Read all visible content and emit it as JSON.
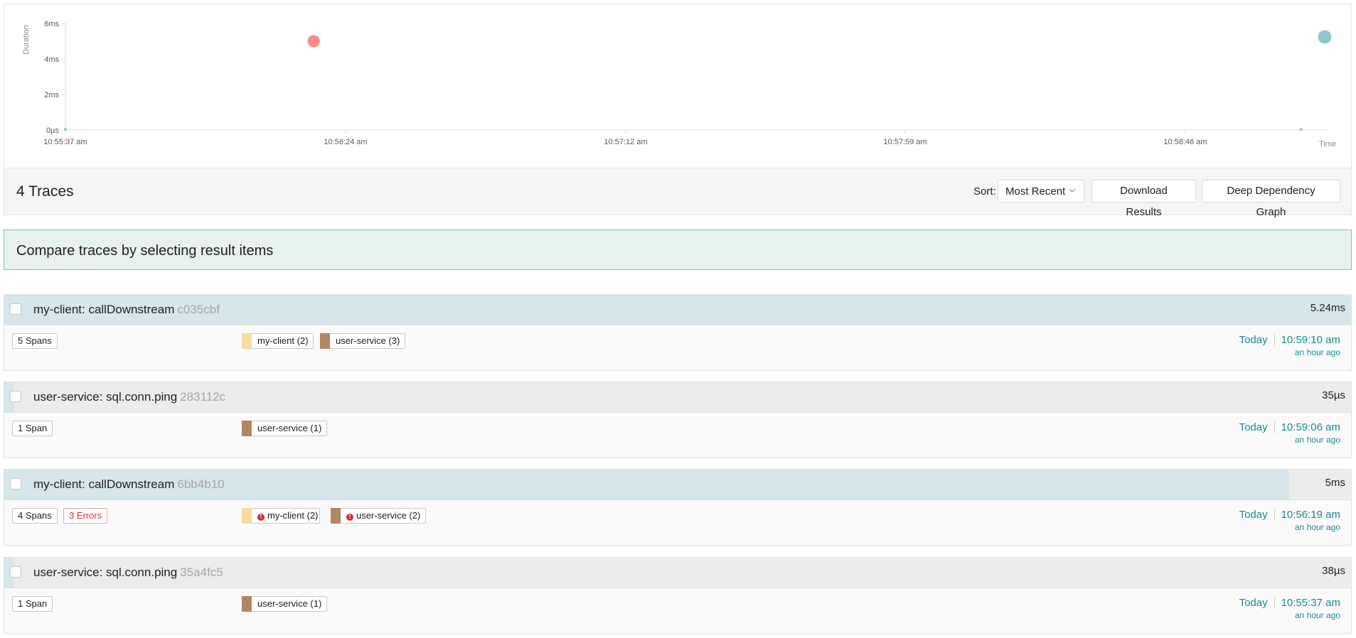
{
  "plot": {
    "y_axis_title": "Duration",
    "x_axis_title": "Time",
    "y_ticks": [
      "6ms",
      "4ms",
      "2ms",
      "0µs"
    ],
    "x_ticks": [
      "10:55:37 am",
      "10:56:24 am",
      "10:57:12 am",
      "10:57:59 am",
      "10:58:46 am"
    ],
    "colors": {
      "error_point": "#ff8a8a",
      "normal_point": "#8fc8cc"
    }
  },
  "header": {
    "count": "4 Traces",
    "sort_label": "Sort:",
    "sort_value": "Most Recent",
    "download_label": "Download Results",
    "ddg_label": "Deep Dependency Graph"
  },
  "compare": {
    "text": "Compare traces by selecting result items"
  },
  "traces": [
    {
      "name": "my-client: callDownstream",
      "id": "c035cbf",
      "duration": "5.24ms",
      "duration_fraction": 1.0,
      "spans": "5 Spans",
      "errors": "",
      "services": [
        {
          "label": "my-client (2)",
          "color": "#f7dca0",
          "error": false
        },
        {
          "label": "user-service (3)",
          "color": "#b08663",
          "error": false
        }
      ],
      "day": "Today",
      "time": "10:59:10 am",
      "ago": "an hour ago"
    },
    {
      "name": "user-service: sql.conn.ping",
      "id": "283112c",
      "duration": "35µs",
      "duration_fraction": 0.007,
      "spans": "1 Span",
      "errors": "",
      "services": [
        {
          "label": "user-service (1)",
          "color": "#b08663",
          "error": false
        }
      ],
      "day": "Today",
      "time": "10:59:06 am",
      "ago": "an hour ago"
    },
    {
      "name": "my-client: callDownstream",
      "id": "6bb4b10",
      "duration": "5ms",
      "duration_fraction": 0.954,
      "spans": "4 Spans",
      "errors": "3 Errors",
      "services": [
        {
          "label": "my-client (2)",
          "color": "#f7dca0",
          "error": true
        },
        {
          "label": "user-service (2)",
          "color": "#b08663",
          "error": true
        }
      ],
      "day": "Today",
      "time": "10:56:19 am",
      "ago": "an hour ago"
    },
    {
      "name": "user-service: sql.conn.ping",
      "id": "35a4fc5",
      "duration": "38µs",
      "duration_fraction": 0.007,
      "spans": "1 Span",
      "errors": "",
      "services": [
        {
          "label": "user-service (1)",
          "color": "#b08663",
          "error": false
        }
      ],
      "day": "Today",
      "time": "10:55:37 am",
      "ago": "an hour ago"
    }
  ],
  "chart_data": {
    "type": "scatter",
    "xlabel": "Time",
    "ylabel": "Duration",
    "x_ticks": [
      "10:55:37 am",
      "10:56:24 am",
      "10:57:12 am",
      "10:57:59 am",
      "10:58:46 am"
    ],
    "y_ticks": [
      "0µs",
      "2ms",
      "4ms",
      "6ms"
    ],
    "ylim_ms": [
      0,
      6
    ],
    "series": [
      {
        "points": [
          {
            "x": "10:55:37 am",
            "y_ms": 0.038,
            "spans": 1,
            "error": false
          },
          {
            "x": "10:56:19 am",
            "y_ms": 5.0,
            "spans": 4,
            "error": true
          },
          {
            "x": "10:59:06 am",
            "y_ms": 0.035,
            "spans": 1,
            "error": false
          },
          {
            "x": "10:59:10 am",
            "y_ms": 5.24,
            "spans": 5,
            "error": false
          }
        ]
      }
    ]
  }
}
